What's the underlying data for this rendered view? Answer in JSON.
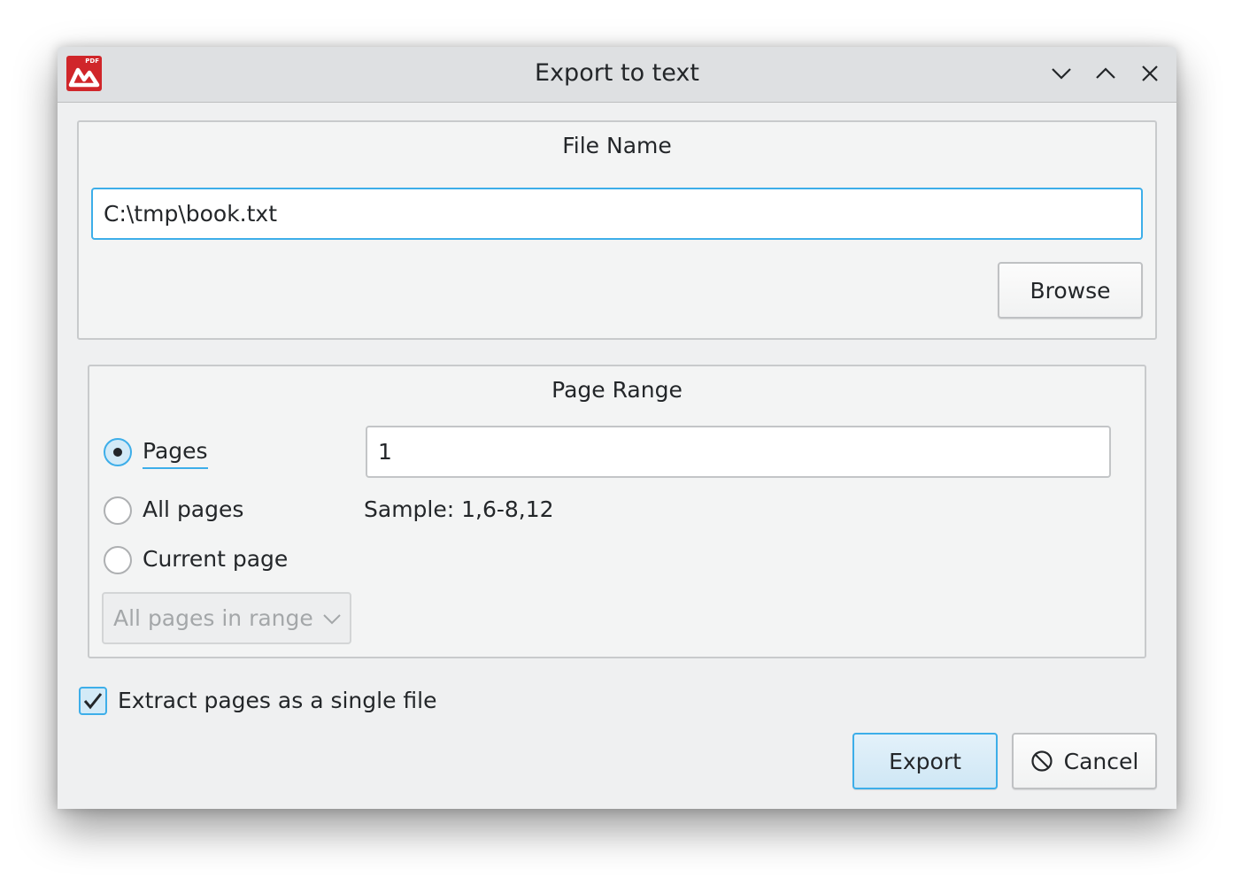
{
  "window": {
    "title": "Export to text",
    "app_icon_text": "PDF"
  },
  "file_name_group": {
    "title": "File Name",
    "path_value": "C:\\tmp\\book.txt",
    "browse_label": "Browse"
  },
  "page_range_group": {
    "title": "Page Range",
    "options": [
      {
        "label": "Pages",
        "checked": true
      },
      {
        "label": "All pages",
        "checked": false
      },
      {
        "label": "Current page",
        "checked": false
      }
    ],
    "pages_value": "1",
    "sample_text": "Sample: 1,6-8,12",
    "subset_select": "All pages in range"
  },
  "single_file_checkbox": {
    "label": "Extract pages as a single file",
    "checked": true
  },
  "buttons": {
    "export_label": "Export",
    "cancel_label": "Cancel"
  },
  "colors": {
    "accent": "#3daee9",
    "brand": "#d0262a",
    "window_bg": "#eff0f1"
  },
  "icons": {
    "minimize": "chevron-down-icon",
    "maximize": "chevron-up-icon",
    "close": "close-icon",
    "cancel": "cancel-circle-icon",
    "dropdown": "chevron-down-icon",
    "check": "checkmark-icon"
  }
}
